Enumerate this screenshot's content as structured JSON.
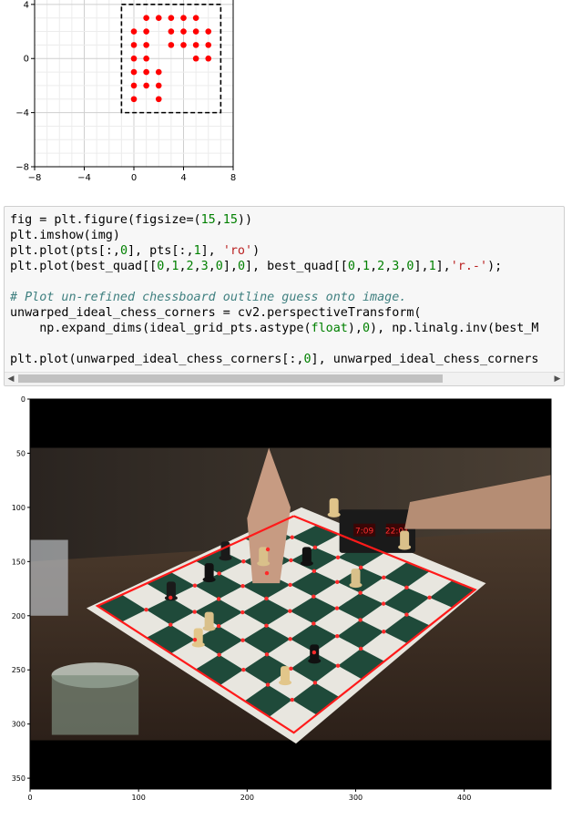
{
  "top_plot": {
    "xticks": [
      "−8",
      "−4",
      "0",
      "4",
      "8"
    ],
    "yticks": [
      "4",
      "0",
      "−4",
      "−8"
    ],
    "chart_data": {
      "type": "scatter",
      "xlim": [
        -8,
        8
      ],
      "ylim": [
        -8,
        5
      ],
      "grid": true,
      "points": [
        [
          0,
          2
        ],
        [
          0,
          1
        ],
        [
          0,
          0
        ],
        [
          0,
          -1
        ],
        [
          0,
          -2
        ],
        [
          0,
          -3
        ],
        [
          1,
          3
        ],
        [
          1,
          2
        ],
        [
          1,
          1
        ],
        [
          1,
          0
        ],
        [
          1,
          -1
        ],
        [
          1,
          -2
        ],
        [
          2,
          3
        ],
        [
          2,
          -1
        ],
        [
          2,
          -2
        ],
        [
          2,
          -3
        ],
        [
          3,
          3
        ],
        [
          3,
          2
        ],
        [
          3,
          1
        ],
        [
          4,
          3
        ],
        [
          4,
          2
        ],
        [
          4,
          1
        ],
        [
          5,
          3
        ],
        [
          5,
          2
        ],
        [
          5,
          1
        ],
        [
          5,
          0
        ],
        [
          6,
          2
        ],
        [
          6,
          1
        ],
        [
          6,
          0
        ]
      ],
      "point_color": "#ff0000",
      "outline": [
        [
          -1,
          4
        ],
        [
          7,
          4
        ],
        [
          7,
          -4
        ],
        [
          -1,
          -4
        ],
        [
          -1,
          4
        ]
      ],
      "outline_color": "#000000"
    }
  },
  "code_cell": {
    "lines": [
      [
        {
          "t": "fig = plt.figure(figsize=("
        },
        {
          "t": "15",
          "c": "n"
        },
        {
          "t": ","
        },
        {
          "t": "15",
          "c": "n"
        },
        {
          "t": "))"
        }
      ],
      [
        {
          "t": "plt.imshow(img)"
        }
      ],
      [
        {
          "t": "plt.plot(pts[:,"
        },
        {
          "t": "0",
          "c": "n"
        },
        {
          "t": "], pts[:,"
        },
        {
          "t": "1",
          "c": "n"
        },
        {
          "t": "], "
        },
        {
          "t": "'ro'",
          "c": "s"
        },
        {
          "t": ")"
        }
      ],
      [
        {
          "t": "plt.plot(best_quad[["
        },
        {
          "t": "0",
          "c": "n"
        },
        {
          "t": ","
        },
        {
          "t": "1",
          "c": "n"
        },
        {
          "t": ","
        },
        {
          "t": "2",
          "c": "n"
        },
        {
          "t": ","
        },
        {
          "t": "3",
          "c": "n"
        },
        {
          "t": ","
        },
        {
          "t": "0",
          "c": "n"
        },
        {
          "t": "],"
        },
        {
          "t": "0",
          "c": "n"
        },
        {
          "t": "], best_quad[["
        },
        {
          "t": "0",
          "c": "n"
        },
        {
          "t": ","
        },
        {
          "t": "1",
          "c": "n"
        },
        {
          "t": ","
        },
        {
          "t": "2",
          "c": "n"
        },
        {
          "t": ","
        },
        {
          "t": "3",
          "c": "n"
        },
        {
          "t": ","
        },
        {
          "t": "0",
          "c": "n"
        },
        {
          "t": "],"
        },
        {
          "t": "1",
          "c": "n"
        },
        {
          "t": "],"
        },
        {
          "t": "'r.-'",
          "c": "s"
        },
        {
          "t": ");"
        }
      ],
      [
        {
          "t": ""
        }
      ],
      [
        {
          "t": "# Plot un-refined chessboard outline guess onto image.",
          "c": "c"
        }
      ],
      [
        {
          "t": "unwarped_ideal_chess_corners = cv2.perspectiveTransform("
        }
      ],
      [
        {
          "t": "    np.expand_dims(ideal_grid_pts.astype("
        },
        {
          "t": "float",
          "c": "n"
        },
        {
          "t": "),"
        },
        {
          "t": "0",
          "c": "n"
        },
        {
          "t": "), np.linalg.inv(best_M"
        }
      ],
      [
        {
          "t": ""
        }
      ],
      [
        {
          "t": "plt.plot(unwarped_ideal_chess_corners[:,"
        },
        {
          "t": "0",
          "c": "n"
        },
        {
          "t": "], unwarped_ideal_chess_corners"
        }
      ]
    ]
  },
  "image_plot": {
    "xticks": [
      "0",
      "100",
      "200",
      "300",
      "400"
    ],
    "yticks": [
      "0",
      "50",
      "100",
      "150",
      "200",
      "250",
      "300",
      "350"
    ],
    "clock_left": "7:09",
    "clock_right": "22:01",
    "chart_data": {
      "type": "image-overlay",
      "xlim": [
        0,
        480
      ],
      "ylim": [
        360,
        0
      ],
      "quad": [
        [
          243,
          108
        ],
        [
          410,
          176
        ],
        [
          243,
          308
        ],
        [
          62,
          191
        ],
        [
          243,
          108
        ]
      ],
      "quad_color": "#ff1a1a",
      "corner_color": "#ff2a2a"
    }
  }
}
